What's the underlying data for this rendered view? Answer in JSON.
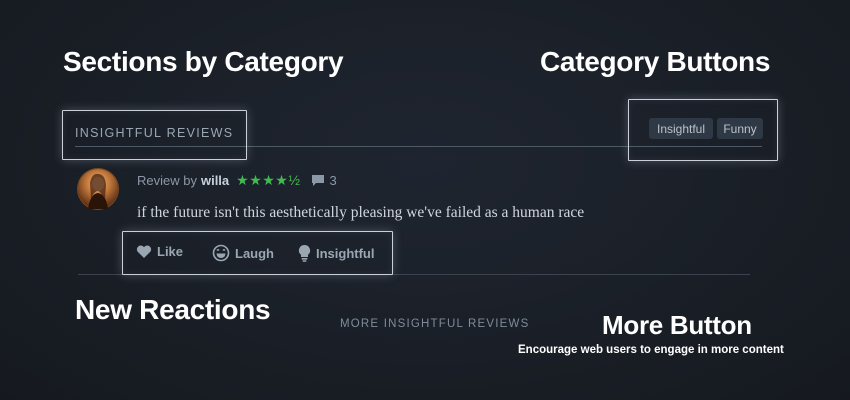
{
  "annotations": {
    "sections_title": "Sections by Category",
    "category_buttons_title": "Category Buttons",
    "new_reactions_title": "New Reactions",
    "more_button_title": "More Button",
    "more_button_subtitle": "Encourage web users to engage in more content"
  },
  "section": {
    "label": "INSIGHTFUL REVIEWS",
    "category_buttons": [
      {
        "label": "Insightful"
      },
      {
        "label": "Funny"
      }
    ]
  },
  "review": {
    "prefix": "Review by",
    "author": "willa",
    "stars": "★★★★½",
    "rating": 4.5,
    "comment_count": "3",
    "text": "if the future isn't this aesthetically pleasing we've failed as a human race"
  },
  "reactions": [
    {
      "label": "Like",
      "icon": "heart-icon"
    },
    {
      "label": "Laugh",
      "icon": "laugh-icon"
    },
    {
      "label": "Insightful",
      "icon": "lightbulb-icon"
    }
  ],
  "more": {
    "label": "MORE INSIGHTFUL REVIEWS"
  },
  "colors": {
    "background": "#1a1f27",
    "star_green": "#3fbc4f",
    "text_muted": "#9aa7b3",
    "highlight_outline": "#c9d0d8"
  }
}
